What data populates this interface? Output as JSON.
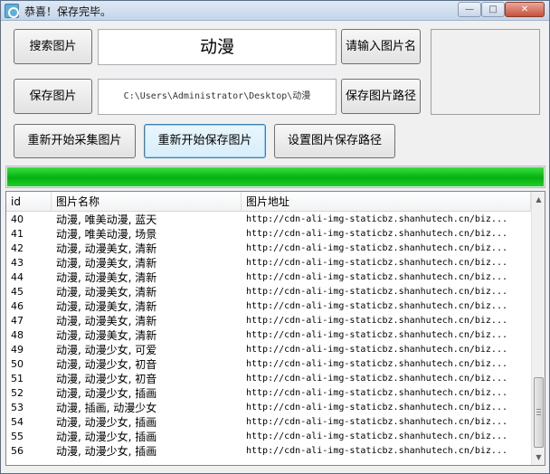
{
  "window": {
    "title": "恭喜！保存完毕。",
    "minimize_glyph": "—",
    "maximize_glyph": "□",
    "close_glyph": "✕"
  },
  "controls": {
    "search_button": "搜索图片",
    "keyword_value": "动漫",
    "name_hint_button": "请输入图片名",
    "save_button": "保存图片",
    "save_path_value": "C:\\Users\\Administrator\\Desktop\\动漫",
    "save_path_button": "保存图片路径",
    "restart_collect_button": "重新开始采集图片",
    "restart_save_button": "重新开始保存图片",
    "set_path_button": "设置图片保存路径"
  },
  "progress": {
    "percent": 100
  },
  "table": {
    "columns": [
      "id",
      "图片名称",
      "图片地址"
    ],
    "rows": [
      {
        "id": "40",
        "name": "动漫, 唯美动漫, 蓝天",
        "url": "http://cdn-ali-img-staticbz.shanhutech.cn/biz..."
      },
      {
        "id": "41",
        "name": "动漫, 唯美动漫, 场景",
        "url": "http://cdn-ali-img-staticbz.shanhutech.cn/biz..."
      },
      {
        "id": "42",
        "name": "动漫, 动漫美女, 清新",
        "url": "http://cdn-ali-img-staticbz.shanhutech.cn/biz..."
      },
      {
        "id": "43",
        "name": "动漫, 动漫美女, 清新",
        "url": "http://cdn-ali-img-staticbz.shanhutech.cn/biz..."
      },
      {
        "id": "44",
        "name": "动漫, 动漫美女, 清新",
        "url": "http://cdn-ali-img-staticbz.shanhutech.cn/biz..."
      },
      {
        "id": "45",
        "name": "动漫, 动漫美女, 清新",
        "url": "http://cdn-ali-img-staticbz.shanhutech.cn/biz..."
      },
      {
        "id": "46",
        "name": "动漫, 动漫美女, 清新",
        "url": "http://cdn-ali-img-staticbz.shanhutech.cn/biz..."
      },
      {
        "id": "47",
        "name": "动漫, 动漫美女, 清新",
        "url": "http://cdn-ali-img-staticbz.shanhutech.cn/biz..."
      },
      {
        "id": "48",
        "name": "动漫, 动漫美女, 清新",
        "url": "http://cdn-ali-img-staticbz.shanhutech.cn/biz..."
      },
      {
        "id": "49",
        "name": "动漫, 动漫少女, 可爱",
        "url": "http://cdn-ali-img-staticbz.shanhutech.cn/biz..."
      },
      {
        "id": "50",
        "name": "动漫, 动漫少女, 初音",
        "url": "http://cdn-ali-img-staticbz.shanhutech.cn/biz..."
      },
      {
        "id": "51",
        "name": "动漫, 动漫少女, 初音",
        "url": "http://cdn-ali-img-staticbz.shanhutech.cn/biz..."
      },
      {
        "id": "52",
        "name": "动漫, 动漫少女, 插画",
        "url": "http://cdn-ali-img-staticbz.shanhutech.cn/biz..."
      },
      {
        "id": "53",
        "name": "动漫, 插画, 动漫少女",
        "url": "http://cdn-ali-img-staticbz.shanhutech.cn/biz..."
      },
      {
        "id": "54",
        "name": "动漫, 动漫少女, 插画",
        "url": "http://cdn-ali-img-staticbz.shanhutech.cn/biz..."
      },
      {
        "id": "55",
        "name": "动漫, 动漫少女, 插画",
        "url": "http://cdn-ali-img-staticbz.shanhutech.cn/biz..."
      },
      {
        "id": "56",
        "name": "动漫, 动漫少女, 插画",
        "url": "http://cdn-ali-img-staticbz.shanhutech.cn/biz..."
      }
    ]
  },
  "scrollbar": {
    "up_glyph": "▲",
    "down_glyph": "▼"
  }
}
